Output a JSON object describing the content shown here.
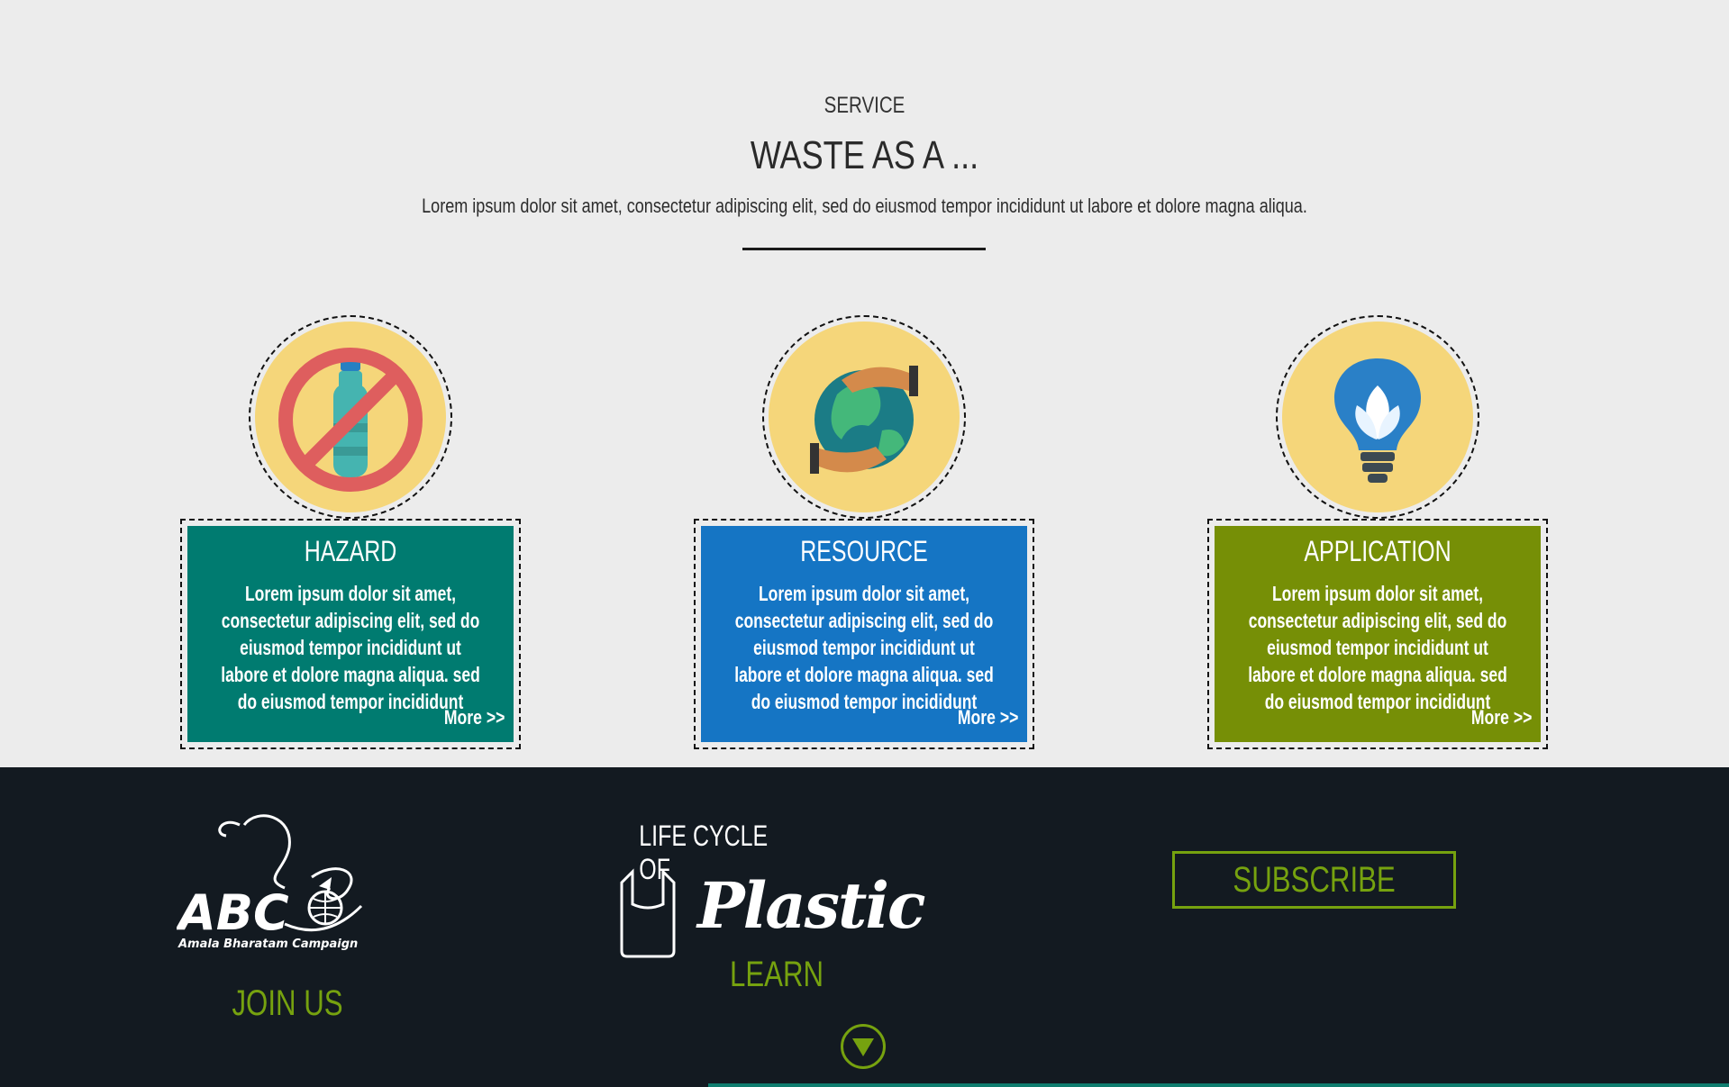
{
  "section": {
    "eyebrow": "SERVICE",
    "title": "WASTE AS A ...",
    "lead": "Lorem ipsum dolor sit amet, consectetur adipiscing elit, sed do eiusmod tempor incididunt ut labore et dolore magna aliqua."
  },
  "cards": [
    {
      "title": "HAZARD",
      "text": "Lorem ipsum dolor sit amet, consectetur adipiscing elit, sed do eiusmod tempor incididunt ut labore et dolore magna aliqua. sed do eiusmod tempor incididunt",
      "more": "More >>",
      "icon": "no-plastic-bottle-icon",
      "color": "#007b70"
    },
    {
      "title": "RESOURCE",
      "text": "Lorem ipsum dolor sit amet, consectetur adipiscing elit, sed do eiusmod tempor incididunt ut labore et dolore magna aliqua. sed do eiusmod tempor incididunt",
      "more": "More >>",
      "icon": "globe-hands-icon",
      "color": "#1575c4"
    },
    {
      "title": "APPLICATION",
      "text": "Lorem ipsum dolor sit amet, consectetur adipiscing elit, sed do eiusmod tempor incididunt ut labore et dolore magna aliqua. sed do eiusmod tempor incididunt",
      "more": "More >>",
      "icon": "leaf-bulb-icon",
      "color": "#768f06"
    }
  ],
  "band": {
    "logo_text": "ABC",
    "logo_tagline": "Amala Bharatam Campaign",
    "join_label": "JOIN US",
    "life_cycle_label": "LIFE CYCLE OF",
    "plastic_label": "Plastic",
    "learn_label": "LEARN",
    "subscribe_label": "SUBSCRIBE",
    "accent": "#76a20f",
    "background": "#131a21"
  }
}
